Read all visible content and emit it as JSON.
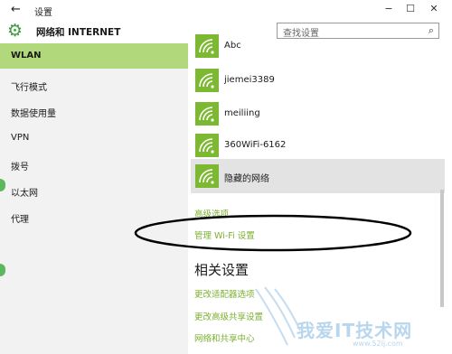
{
  "window": {
    "title": "设置",
    "back_icon": "arrow-left-icon",
    "controls": [
      "minimize-icon",
      "maximize-icon",
      "close-icon"
    ]
  },
  "header": {
    "section_title": "网络和 INTERNET",
    "search_placeholder": "查找设置"
  },
  "sidebar": {
    "items": [
      {
        "label": "WLAN",
        "active": true
      },
      {
        "label": "飞行模式"
      },
      {
        "label": "数据使用量"
      },
      {
        "label": "VPN"
      },
      {
        "label": "拨号"
      },
      {
        "label": "以太网"
      },
      {
        "label": "代理"
      }
    ]
  },
  "networks": [
    {
      "name": "Abc"
    },
    {
      "name": "jiemei3389"
    },
    {
      "name": "meiliing"
    },
    {
      "name": "360WiFi-6162"
    },
    {
      "name": "隐藏的网络",
      "highlighted": true
    }
  ],
  "links": {
    "advanced": "高级选项",
    "manage_wifi": "管理 Wi-Fi 设置"
  },
  "related": {
    "title": "相关设置",
    "items": [
      "更改适配器选项",
      "更改高级共享设置",
      "网络和共享中心"
    ]
  },
  "watermark": {
    "text": "我爱IT技术网",
    "url": "www.52ij.com"
  },
  "colors": {
    "accent": "#7db832",
    "active_nav": "#b1d97c",
    "link": "#7bb02f"
  }
}
